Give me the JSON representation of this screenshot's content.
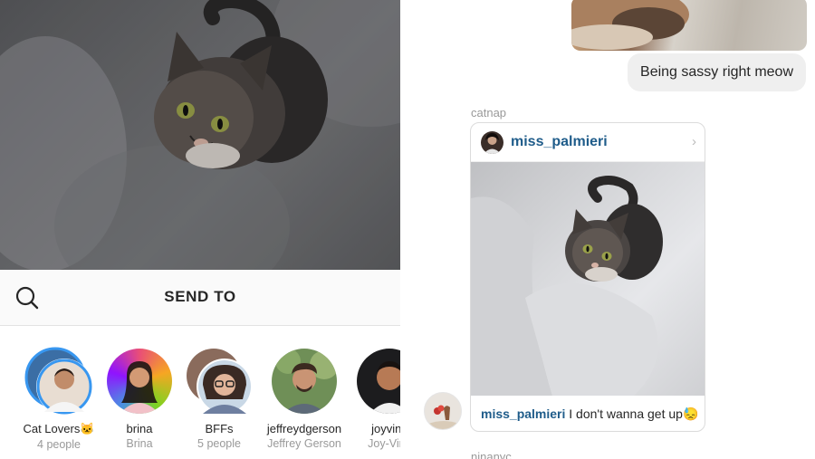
{
  "compose": {
    "header_title": "SEND TO"
  },
  "recipients": [
    {
      "name": "Cat Lovers🐱",
      "subtitle": "4 people"
    },
    {
      "name": "brina",
      "subtitle": "Brina"
    },
    {
      "name": "BFFs",
      "subtitle": "5 people"
    },
    {
      "name": "jeffreydgerson",
      "subtitle": "Jeffrey Gerson"
    },
    {
      "name": "joyvinc",
      "subtitle": "Joy-Vinc"
    }
  ],
  "thread": {
    "outgoing_message": "Being sassy right meow",
    "sender_label_1": "catnap",
    "shared_post": {
      "username": "miss_palmieri",
      "caption_user": "miss_palmieri",
      "caption_text": " I don't wanna get up😓"
    },
    "sender_label_2": "ninanyc"
  },
  "colors": {
    "username_link": "#1f5c8a",
    "story_ring": "#3897f0",
    "bubble_bg": "#efefef"
  }
}
